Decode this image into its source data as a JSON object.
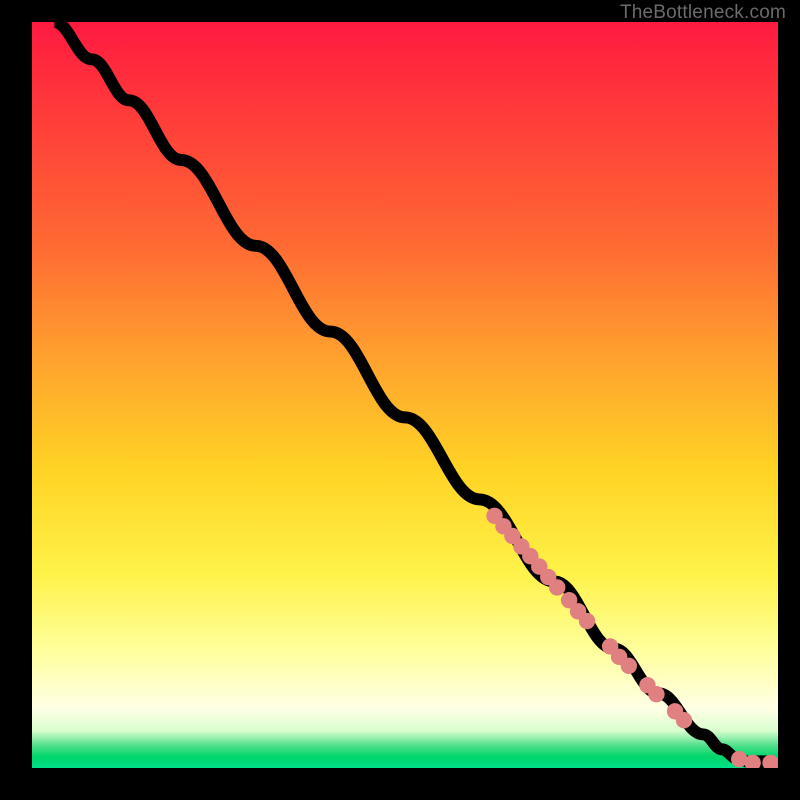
{
  "attribution": "TheBottleneck.com",
  "colors": {
    "point_fill": "#e08080",
    "curve_stroke": "#000000"
  },
  "chart_data": {
    "type": "scatter",
    "title": "",
    "xlabel": "",
    "ylabel": "",
    "xlim": [
      0,
      100
    ],
    "ylim": [
      0,
      100
    ],
    "curve": {
      "description": "monotone decreasing bottleneck curve from top-left to bottom-right",
      "points_xy": [
        [
          3,
          100
        ],
        [
          8,
          95
        ],
        [
          13,
          89.5
        ],
        [
          20,
          81.5
        ],
        [
          30,
          70
        ],
        [
          40,
          58.5
        ],
        [
          50,
          47
        ],
        [
          60,
          36
        ],
        [
          70,
          25
        ],
        [
          78,
          16
        ],
        [
          84,
          10
        ],
        [
          90,
          4.5
        ],
        [
          92.5,
          2.5
        ],
        [
          94.5,
          1.3
        ],
        [
          96.5,
          0.7
        ]
      ],
      "tail_flat_to_x": 99
    },
    "series": [
      {
        "name": "cluster-points",
        "marker": "circle",
        "size_vw": 1.1,
        "points_xy": [
          [
            62.0,
            33.8
          ],
          [
            63.2,
            32.4
          ],
          [
            64.4,
            31.1
          ],
          [
            65.6,
            29.7
          ],
          [
            66.8,
            28.4
          ],
          [
            68.0,
            27.0
          ],
          [
            69.2,
            25.6
          ],
          [
            70.4,
            24.2
          ],
          [
            72.0,
            22.5
          ],
          [
            73.2,
            21.0
          ],
          [
            74.4,
            19.7
          ],
          [
            77.5,
            16.3
          ],
          [
            78.7,
            14.9
          ],
          [
            80.0,
            13.7
          ],
          [
            82.5,
            11.1
          ],
          [
            83.7,
            9.9
          ],
          [
            86.2,
            7.6
          ],
          [
            87.4,
            6.4
          ],
          [
            94.8,
            1.2
          ],
          [
            96.6,
            0.7
          ],
          [
            99.0,
            0.7
          ]
        ]
      }
    ]
  }
}
